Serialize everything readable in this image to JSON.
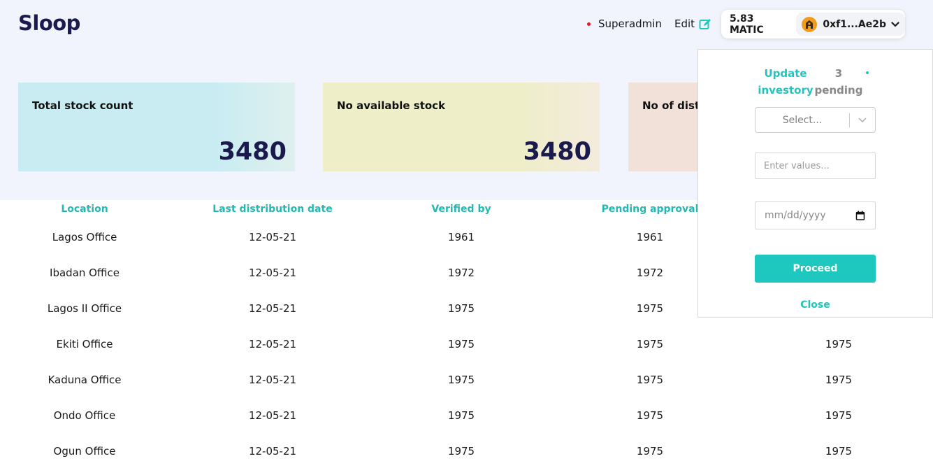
{
  "header": {
    "logo": "Sloop",
    "role": "Superadmin",
    "edit_label": "Edit",
    "balance": "5.83 MATIC",
    "address": "0xf1...Ae2b"
  },
  "stats": [
    {
      "label": "Total stock count",
      "value": "3480"
    },
    {
      "label": "No available stock",
      "value": "3480"
    },
    {
      "label": "No of distr",
      "value": ""
    }
  ],
  "table": {
    "columns": [
      "Location",
      "Last distribution date",
      "Verified by",
      "Pending approval",
      ""
    ],
    "rows": [
      {
        "location": "Lagos Office",
        "date": "12-05-21",
        "verified": "1961",
        "pending": "1961",
        "extra": ""
      },
      {
        "location": "Ibadan Office",
        "date": "12-05-21",
        "verified": "1972",
        "pending": "1972",
        "extra": ""
      },
      {
        "location": "Lagos II Office",
        "date": "12-05-21",
        "verified": "1975",
        "pending": "1975",
        "extra": ""
      },
      {
        "location": "Ekiti Office",
        "date": "12-05-21",
        "verified": "1975",
        "pending": "1975",
        "extra": "1975"
      },
      {
        "location": "Kaduna Office",
        "date": "12-05-21",
        "verified": "1975",
        "pending": "1975",
        "extra": "1975"
      },
      {
        "location": "Ondo Office",
        "date": "12-05-21",
        "verified": "1975",
        "pending": "1975",
        "extra": "1975"
      },
      {
        "location": "Ogun Office",
        "date": "12-05-21",
        "verified": "1975",
        "pending": "1975",
        "extra": "1975"
      }
    ]
  },
  "panel": {
    "title_update": "Update investory",
    "title_pending": "3 pending",
    "select_placeholder": "Select...",
    "input_placeholder": "Enter values...",
    "date_placeholder": "mm/dd/yyyy",
    "proceed_label": "Proceed",
    "close_label": "Close"
  },
  "colors": {
    "brand_navy": "#1b1a4e",
    "accent_teal": "#1ec8be",
    "role_dot": "#e11d1d",
    "card_blue": "#c8ecf2",
    "card_yellow": "#eeeec8",
    "card_peach": "#f2e1d8"
  },
  "icons": [
    "edit-icon",
    "account-avatar-icon",
    "chevron-down-icon",
    "calendar-icon"
  ]
}
